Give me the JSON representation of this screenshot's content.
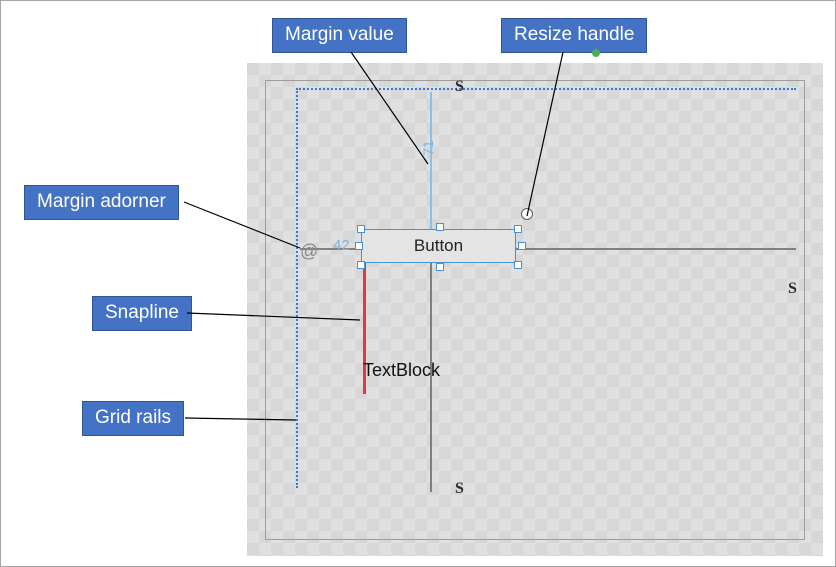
{
  "callouts": {
    "margin_value": "Margin value",
    "resize_handle": "Resize handle",
    "margin_adorner": "Margin adorner",
    "snapline": "Snapline",
    "grid_rails": "Grid rails"
  },
  "designer": {
    "button_label": "Button",
    "textblock_label": "TextBlock",
    "margin_top": "71",
    "margin_left": "42",
    "adorner_glyph": "@",
    "splitter_glyph": "S"
  }
}
